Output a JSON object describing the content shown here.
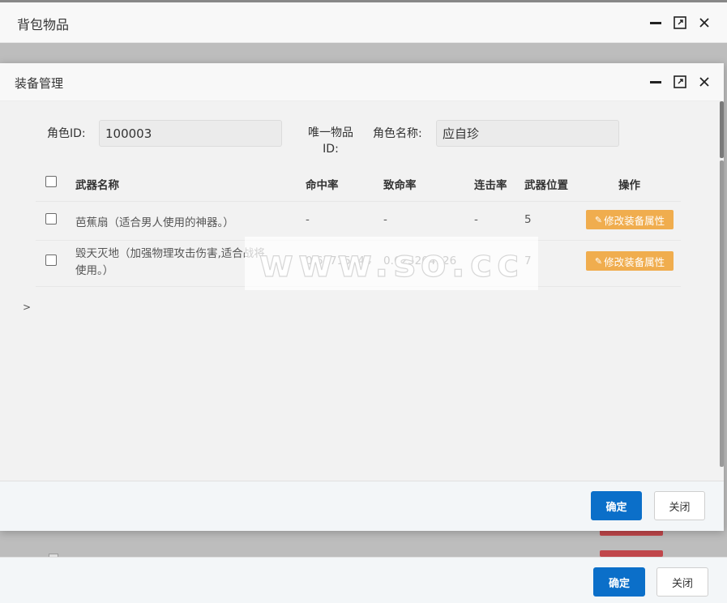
{
  "outer": {
    "title": "背包物品",
    "confirm_label": "确定",
    "close_label": "关闭"
  },
  "inner": {
    "title": "装备管理",
    "form": {
      "role_id_label": "角色ID:",
      "role_id_value": "100003",
      "unique_item_label_1": "唯一物品",
      "unique_item_label_2": "ID:",
      "role_name_label": "角色名称:",
      "role_name_value": "应自珍"
    },
    "table": {
      "headers": [
        "武器名称",
        "命中率",
        "致命率",
        "连击率",
        "武器位置",
        "操作"
      ],
      "rows": [
        {
          "name": "芭蕉扇（适合男人使用的神器。）",
          "name_line2": "",
          "hit": "-",
          "crit": "-",
          "combo": "-",
          "position": "5",
          "action": "修改装备属性"
        },
        {
          "name": "毁天灭地（加强物理攻击伤害,适合战将",
          "name_line2": "使用。）",
          "hit": "0.67715744",
          "crit": "0.625204126",
          "combo": "-",
          "position": "7",
          "action": "修改装备属性"
        }
      ]
    },
    "expander": ">",
    "confirm_label": "确定",
    "close_label": "关闭"
  },
  "watermark": "www.so.cc",
  "colors": {
    "primary": "#0b6fc9",
    "warning": "#f0ad4e",
    "danger": "#c0474b"
  }
}
